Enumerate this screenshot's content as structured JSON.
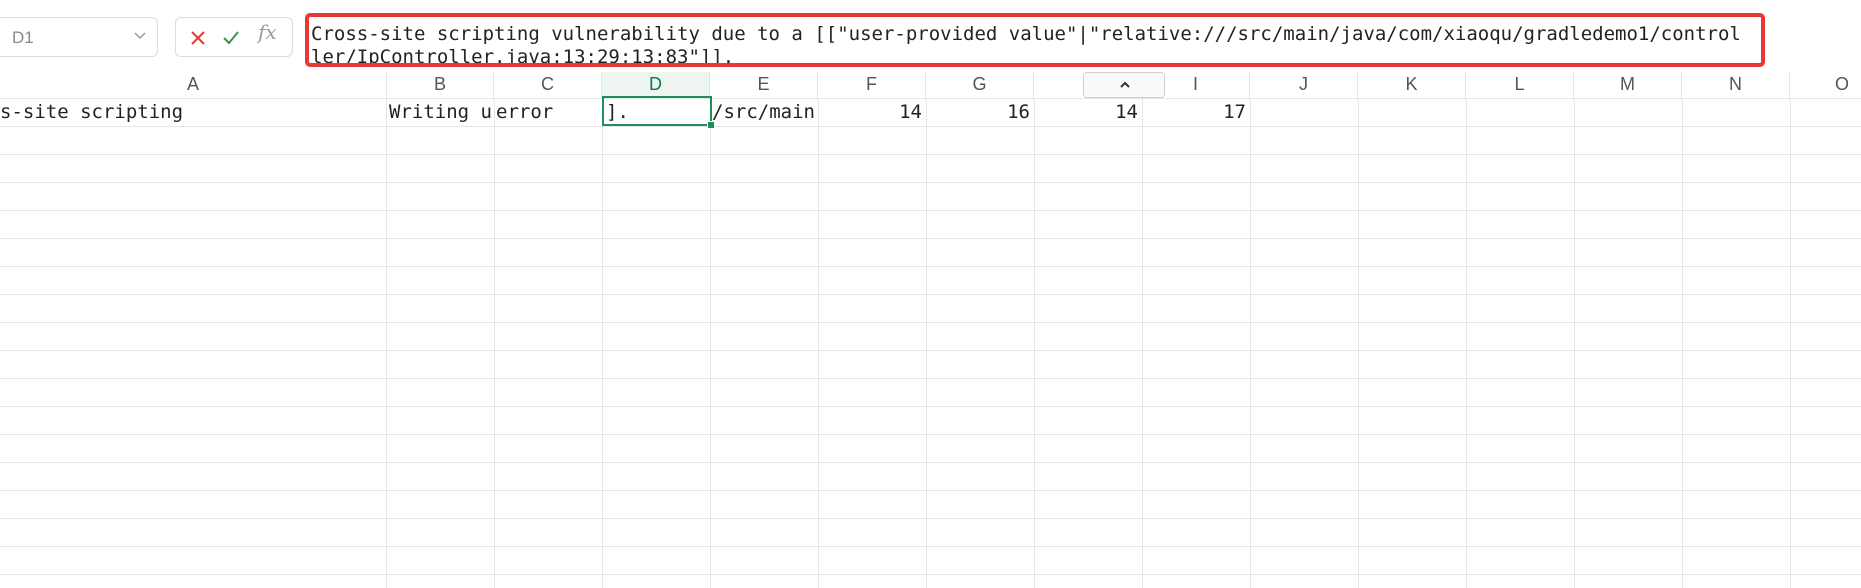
{
  "name_box": {
    "value": "D1"
  },
  "formula_bar": {
    "fx_label": "fx",
    "content": "Cross-site scripting vulnerability due to a [[\"user-provided value\"|\"relative:///src/main/java/com/xiaoqu/gradledemo1/controller/IpController.java:13:29:13:83\"]]."
  },
  "columns": [
    "A",
    "B",
    "C",
    "D",
    "E",
    "F",
    "G",
    "H",
    "I",
    "J",
    "K",
    "L",
    "M",
    "N",
    "O"
  ],
  "active_column": "D",
  "row1": {
    "A": "s-site scripting",
    "B": "Writing us",
    "C": "error",
    "D": "].",
    "E": "/src/main/",
    "F": "14",
    "G": "16",
    "H": "14",
    "I": "17"
  },
  "colors": {
    "highlight_border": "#e53935",
    "selection": "#1e8e5a",
    "cancel_icon": "#e53935",
    "confirm_icon": "#2e9a4f"
  }
}
